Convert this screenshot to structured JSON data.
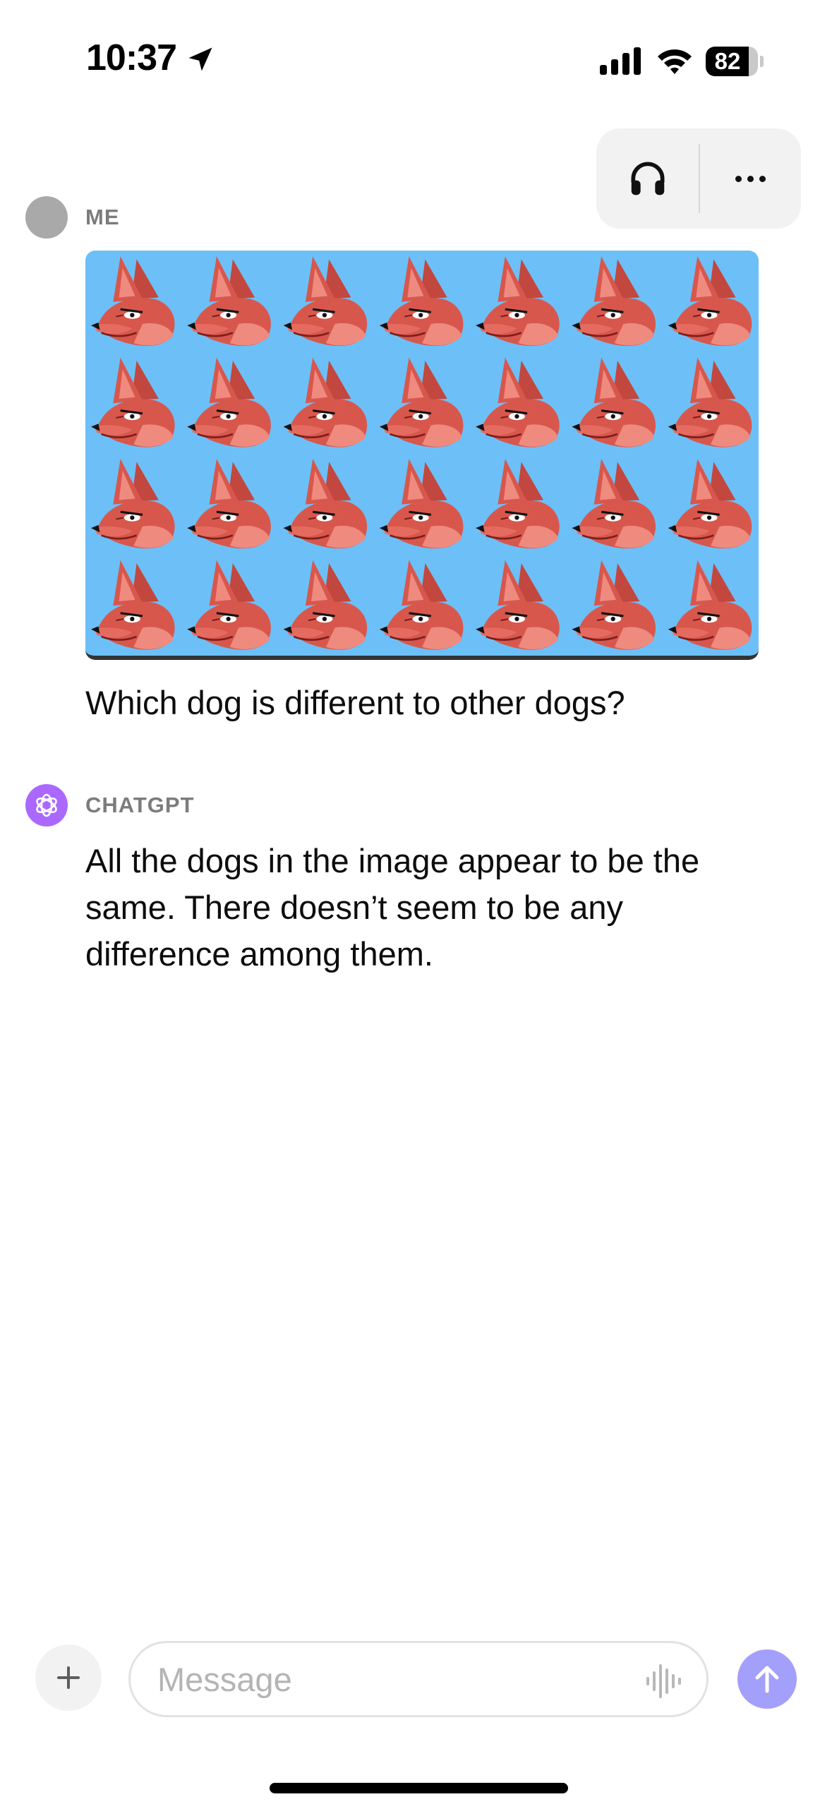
{
  "status_bar": {
    "time": "10:37",
    "battery_percent": "82",
    "battery_level": 0.82,
    "icons": [
      "location-arrow-icon",
      "cellular-signal-icon",
      "wifi-icon",
      "battery-icon"
    ]
  },
  "header": {
    "icons": [
      "headphones-icon",
      "more-icon"
    ]
  },
  "conversation": {
    "user": {
      "sender": "ME",
      "text": "Which dog is different to other dogs?",
      "image": {
        "rows": 4,
        "columns": 7,
        "background": "#6cc0f7",
        "subject": "red cartoon dog head"
      }
    },
    "assistant": {
      "sender": "CHATGPT",
      "text": "All the dogs in the image appear to be the same. There doesn’t seem to be any difference among them.",
      "avatar_color": "#ab68ff"
    }
  },
  "composer": {
    "placeholder": "Message",
    "icons": [
      "plus-icon",
      "voice-waveform-icon",
      "send-arrow-icon"
    ],
    "send_color": "#a3a0fb"
  }
}
